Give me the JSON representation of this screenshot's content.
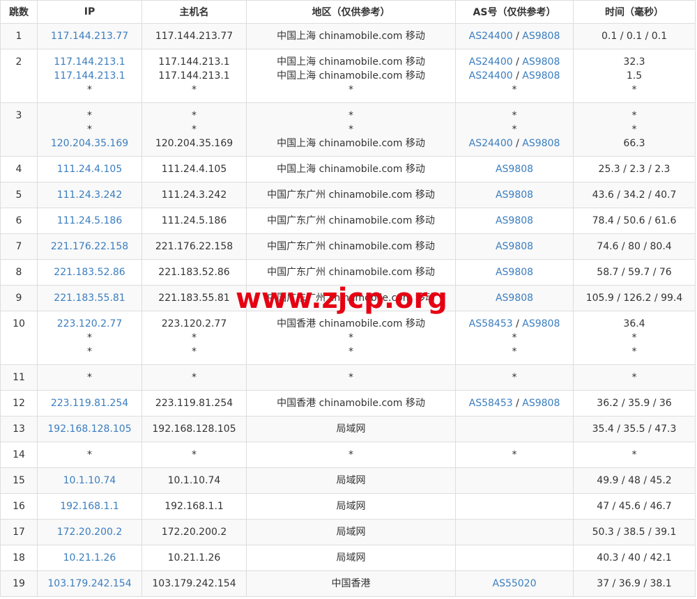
{
  "headers": [
    "跳数",
    "IP",
    "主机名",
    "地区（仅供参考）",
    "AS号（仅供参考）",
    "时间（毫秒）"
  ],
  "rows": [
    {
      "hop": "1",
      "lines": [
        {
          "ip": "117.144.213.77",
          "host": "117.144.213.77",
          "region": "中国上海 chinamobile.com 移动",
          "as": [
            "AS24400",
            "AS9808"
          ],
          "time": "0.1 / 0.1 / 0.1"
        }
      ]
    },
    {
      "hop": "2",
      "lines": [
        {
          "ip": "117.144.213.1",
          "host": "117.144.213.1",
          "region": "中国上海 chinamobile.com 移动",
          "as": [
            "AS24400",
            "AS9808"
          ],
          "time": "32.3"
        },
        {
          "ip": "117.144.213.1",
          "host": "117.144.213.1",
          "region": "中国上海 chinamobile.com 移动",
          "as": [
            "AS24400",
            "AS9808"
          ],
          "time": "1.5"
        },
        {
          "ip": "*",
          "host": "*",
          "region": "*",
          "as_text": "*",
          "time": "*"
        }
      ]
    },
    {
      "hop": "3",
      "lines": [
        {
          "ip": "*",
          "host": "*",
          "region": "*",
          "as_text": "*",
          "time": "*"
        },
        {
          "ip": "*",
          "host": "*",
          "region": "*",
          "as_text": "*",
          "time": "*"
        },
        {
          "ip": "120.204.35.169",
          "host": "120.204.35.169",
          "region": "中国上海 chinamobile.com 移动",
          "as": [
            "AS24400",
            "AS9808"
          ],
          "time": "66.3"
        }
      ]
    },
    {
      "hop": "4",
      "lines": [
        {
          "ip": "111.24.4.105",
          "host": "111.24.4.105",
          "region": "中国上海 chinamobile.com 移动",
          "as": [
            "AS9808"
          ],
          "time": "25.3 / 2.3 / 2.3"
        }
      ]
    },
    {
      "hop": "5",
      "lines": [
        {
          "ip": "111.24.3.242",
          "host": "111.24.3.242",
          "region": "中国广东广州 chinamobile.com 移动",
          "as": [
            "AS9808"
          ],
          "time": "43.6 / 34.2 / 40.7"
        }
      ]
    },
    {
      "hop": "6",
      "lines": [
        {
          "ip": "111.24.5.186",
          "host": "111.24.5.186",
          "region": "中国广东广州 chinamobile.com 移动",
          "as": [
            "AS9808"
          ],
          "time": "78.4 / 50.6 / 61.6"
        }
      ]
    },
    {
      "hop": "7",
      "lines": [
        {
          "ip": "221.176.22.158",
          "host": "221.176.22.158",
          "region": "中国广东广州 chinamobile.com 移动",
          "as": [
            "AS9808"
          ],
          "time": "74.6 / 80 / 80.4"
        }
      ]
    },
    {
      "hop": "8",
      "lines": [
        {
          "ip": "221.183.52.86",
          "host": "221.183.52.86",
          "region": "中国广东广州 chinamobile.com 移动",
          "as": [
            "AS9808"
          ],
          "time": "58.7 / 59.7 / 76"
        }
      ]
    },
    {
      "hop": "9",
      "lines": [
        {
          "ip": "221.183.55.81",
          "host": "221.183.55.81",
          "region": "中国广东广州 chinamobile.com 移动",
          "as": [
            "AS9808"
          ],
          "time": "105.9 / 126.2 / 99.4"
        }
      ]
    },
    {
      "hop": "10",
      "lines": [
        {
          "ip": "223.120.2.77",
          "host": "223.120.2.77",
          "region": "中国香港 chinamobile.com 移动",
          "as": [
            "AS58453",
            "AS9808"
          ],
          "time": "36.4"
        },
        {
          "ip": "*",
          "host": "*",
          "region": "*",
          "as_text": "*",
          "time": "*"
        },
        {
          "ip": "*",
          "host": "*",
          "region": "*",
          "as_text": "*",
          "time": "*"
        }
      ]
    },
    {
      "hop": "11",
      "lines": [
        {
          "ip": "*",
          "host": "*",
          "region": "*",
          "as_text": "*",
          "time": "*"
        }
      ]
    },
    {
      "hop": "12",
      "lines": [
        {
          "ip": "223.119.81.254",
          "host": "223.119.81.254",
          "region": "中国香港 chinamobile.com 移动",
          "as": [
            "AS58453",
            "AS9808"
          ],
          "time": "36.2 / 35.9 / 36"
        }
      ]
    },
    {
      "hop": "13",
      "lines": [
        {
          "ip": "192.168.128.105",
          "host": "192.168.128.105",
          "region": "局域网",
          "as_text": "",
          "time": "35.4 / 35.5 / 47.3"
        }
      ]
    },
    {
      "hop": "14",
      "lines": [
        {
          "ip": "*",
          "host": "*",
          "region": "*",
          "as_text": "*",
          "time": "*"
        }
      ]
    },
    {
      "hop": "15",
      "lines": [
        {
          "ip": "10.1.10.74",
          "host": "10.1.10.74",
          "region": "局域网",
          "as_text": "",
          "time": "49.9 / 48 / 45.2"
        }
      ]
    },
    {
      "hop": "16",
      "lines": [
        {
          "ip": "192.168.1.1",
          "host": "192.168.1.1",
          "region": "局域网",
          "as_text": "",
          "time": "47 / 45.6 / 46.7"
        }
      ]
    },
    {
      "hop": "17",
      "lines": [
        {
          "ip": "172.20.200.2",
          "host": "172.20.200.2",
          "region": "局域网",
          "as_text": "",
          "time": "50.3 / 38.5 / 39.1"
        }
      ]
    },
    {
      "hop": "18",
      "lines": [
        {
          "ip": "10.21.1.26",
          "host": "10.21.1.26",
          "region": "局域网",
          "as_text": "",
          "time": "40.3 / 40 / 42.1"
        }
      ]
    },
    {
      "hop": "19",
      "lines": [
        {
          "ip": "103.179.242.154",
          "host": "103.179.242.154",
          "region": "中国香港",
          "as": [
            "AS55020"
          ],
          "time": "37 / 36.9 / 38.1"
        }
      ]
    }
  ],
  "watermark": "www.zjcp.org",
  "colors": {
    "link": "#3a7dbf",
    "border": "#dddddd",
    "stripe": "#f9f9f9",
    "watermark": "#e60012"
  }
}
